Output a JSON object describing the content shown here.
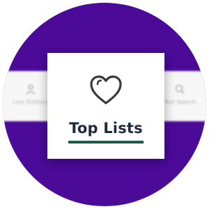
{
  "nav": {
    "left_item": {
      "label": "Live Stations",
      "icon": "person-icon"
    },
    "active_item": {
      "label": "Top Lists",
      "icon": "heart-icon",
      "indicator_color": "#1e5a4a"
    },
    "right_item": {
      "label": "Text Search",
      "icon": "search-icon"
    }
  },
  "colors": {
    "background_circle": "#4b0a98",
    "nav_background": "#f7f7f8",
    "title_color": "#1f2b3a"
  }
}
